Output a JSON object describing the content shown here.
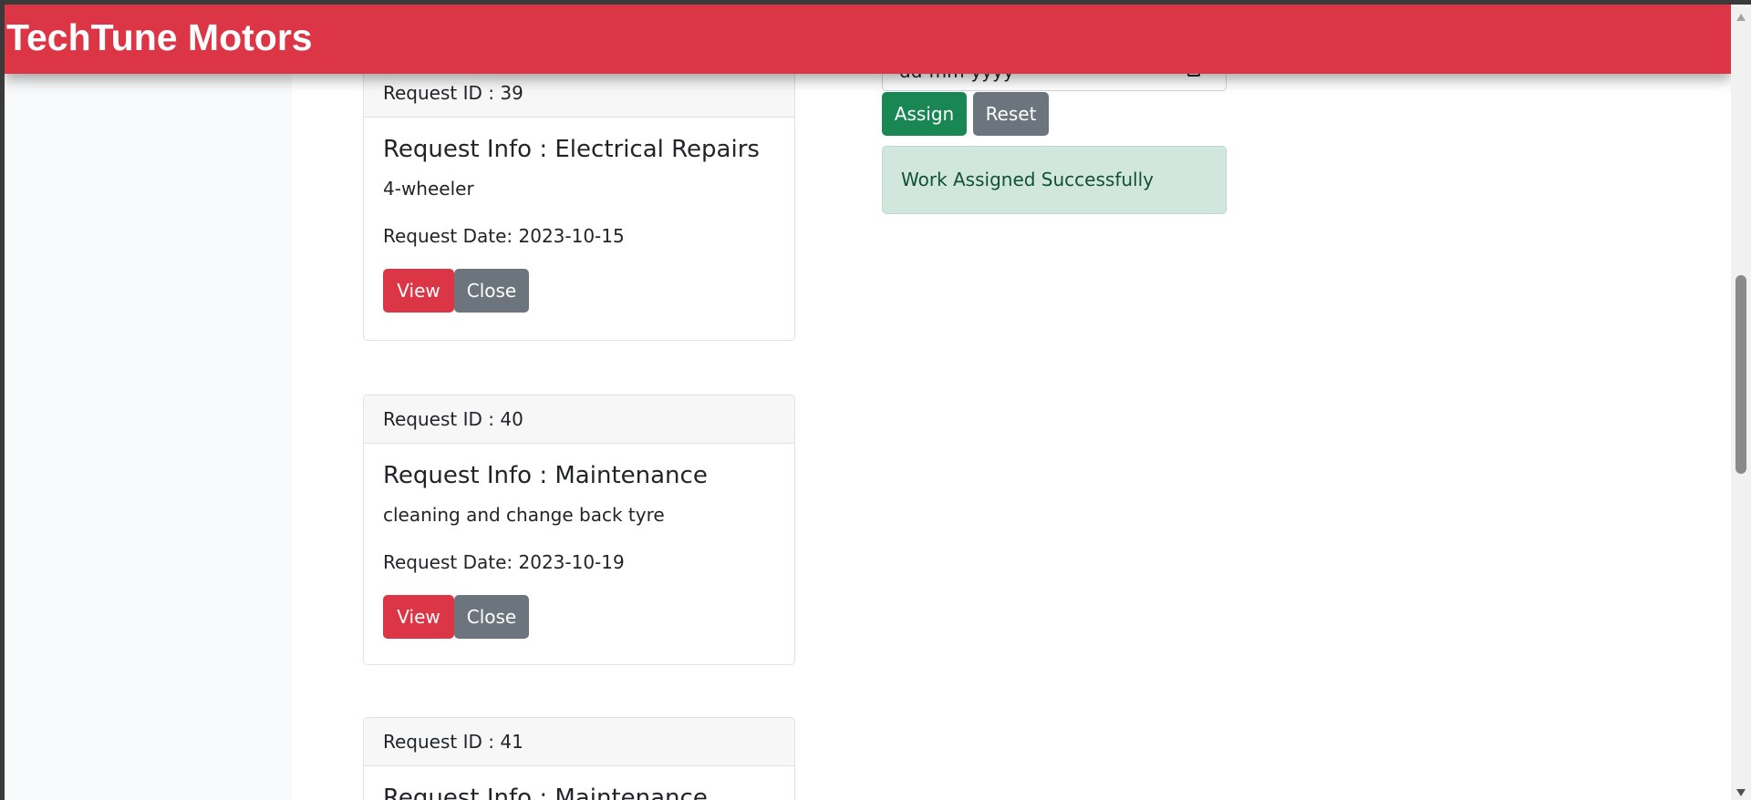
{
  "navbar": {
    "brand": "TechTune Motors",
    "color": "#dc3545"
  },
  "assign_form": {
    "date_placeholder": "dd-mm-yyyy",
    "assign_label": "Assign",
    "reset_label": "Reset",
    "success_message": "Work Assigned Successfully"
  },
  "requests": [
    {
      "header": "Request ID : 39",
      "title": "Request Info : Electrical Repairs",
      "description": "4-wheeler",
      "date": "Request Date: 2023-10-15",
      "view_label": "View",
      "close_label": "Close"
    },
    {
      "header": "Request ID : 40",
      "title": "Request Info : Maintenance",
      "description": "cleaning and change back tyre",
      "date": "Request Date: 2023-10-19",
      "view_label": "View",
      "close_label": "Close"
    },
    {
      "header": "Request ID : 41",
      "title": "Request Info : Maintenance"
    }
  ]
}
